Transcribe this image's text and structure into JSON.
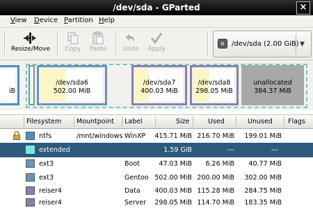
{
  "window": {
    "title": "/dev/sda - GParted",
    "close_glyph": "×"
  },
  "menu": [
    {
      "label": "View",
      "mnemonic": "V"
    },
    {
      "label": "Device",
      "mnemonic": "D"
    },
    {
      "label": "Partition",
      "mnemonic": "P"
    },
    {
      "label": "Help",
      "mnemonic": "H"
    }
  ],
  "toolbar": {
    "resize_move": "Resize/Move",
    "copy": "Copy",
    "paste": "Paste",
    "undo": "Undo",
    "apply": "Apply",
    "device": "/dev/sda",
    "device_size": "(2.00 GiB)"
  },
  "diskmap": {
    "partial_left_size": "iB",
    "partitions": [
      {
        "name": "/dev/sda6",
        "size": "502.00 MiB"
      },
      {
        "name": "/dev/sda7",
        "size": "400.03 MiB"
      },
      {
        "name": "/dev/sda8",
        "size": "298.05 MiB"
      },
      {
        "name": "unallocated",
        "size": "384.37 MiB"
      }
    ]
  },
  "table": {
    "headers": {
      "filesystem": "Filesystem",
      "mountpoint": "Mountpoint",
      "label": "Label",
      "size": "Size",
      "used": "Used",
      "unused": "Unused",
      "flags": "Flags"
    },
    "rows": [
      {
        "filesystem": "ntfs",
        "mountpoint": "/mnt/windows",
        "label": "WinXP",
        "size": "415.71 MiB",
        "used": "216.70 MiB",
        "unused": "199.01 MiB",
        "locked": true,
        "color": "#4d8fc4"
      },
      {
        "filesystem": "extended",
        "mountpoint": "",
        "label": "",
        "size": "1.59 GiB",
        "used": "---",
        "unused": "---",
        "selected": true,
        "color": "#7fe6df"
      },
      {
        "filesystem": "ext3",
        "mountpoint": "",
        "label": "Boot",
        "size": "47.03 MiB",
        "used": "6.26 MiB",
        "unused": "40.77 MiB",
        "color": "#6a94b4"
      },
      {
        "filesystem": "ext3",
        "mountpoint": "",
        "label": "Gentoo",
        "size": "502.00 MiB",
        "used": "200.00 MiB",
        "unused": "302.00 MiB",
        "color": "#6a94b4"
      },
      {
        "filesystem": "reiser4",
        "mountpoint": "",
        "label": "Data",
        "size": "400.03 MiB",
        "used": "115.28 MiB",
        "unused": "284.75 MiB",
        "color": "#8a7fa6"
      },
      {
        "filesystem": "reiser4",
        "mountpoint": "",
        "label": "Server",
        "size": "298.05 MiB",
        "used": "114.70 MiB",
        "unused": "183.35 MiB",
        "color": "#8a7fa6"
      }
    ]
  },
  "colors": {
    "used_fill": "#fbf6c4",
    "free_fill": "#ffffff",
    "unallocated": "#a8a8a8",
    "extended_border": "#6ec9c6",
    "selection": "#2d5a7c",
    "partition_border": "#6e6e6e"
  }
}
